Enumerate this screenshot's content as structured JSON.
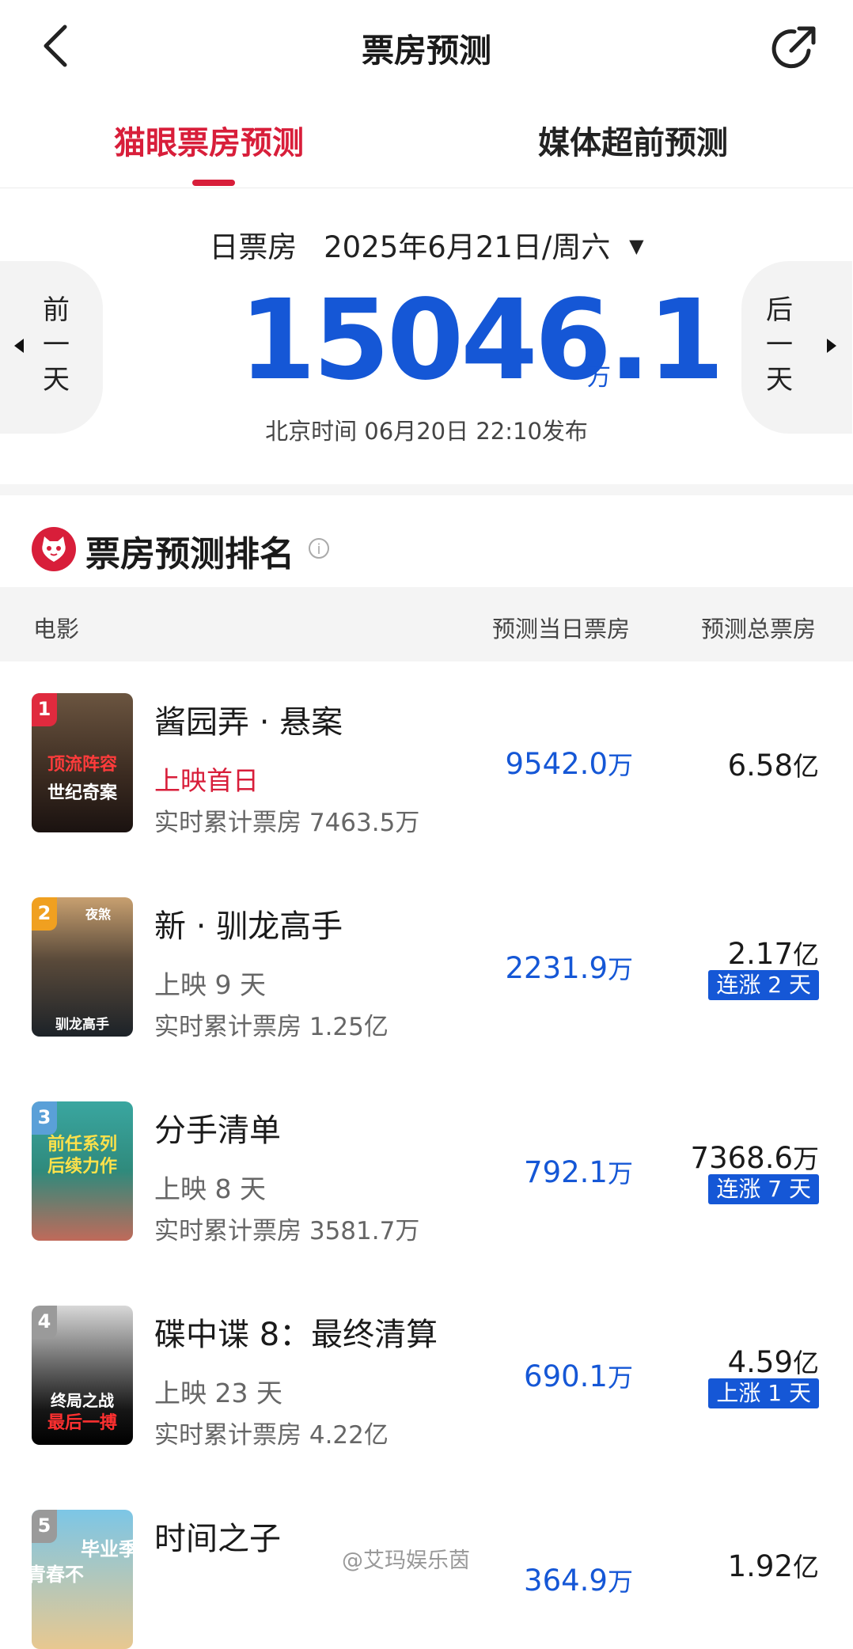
{
  "header": {
    "title": "票房预测"
  },
  "tabs": [
    {
      "label": "猫眼票房预测",
      "active": true
    },
    {
      "label": "媒体超前预测",
      "active": false
    }
  ],
  "date_selector": {
    "label": "日票房",
    "date": "2025年6月21日/周六",
    "caret": "▼"
  },
  "nav": {
    "prev": [
      "前",
      "一",
      "天"
    ],
    "next": [
      "后",
      "一",
      "天"
    ]
  },
  "summary": {
    "value": "15046.1",
    "unit": "万",
    "published": "北京时间  06月20日  22:10发布"
  },
  "ranking": {
    "title": "票房预测排名",
    "columns": {
      "movie": "电影",
      "day": "预测当日票房",
      "total": "预测总票房"
    },
    "rows": [
      {
        "rank": "1",
        "name": "酱园弄 · 悬案",
        "status": "上映首日",
        "status_red": true,
        "cumulative": "实时累计票房 7463.5万",
        "day_value": "9542.0",
        "day_unit": "万",
        "total_value": "6.58",
        "total_unit": "亿",
        "tag": "",
        "poster_text": [
          "顶流阵容",
          "世纪奇案"
        ]
      },
      {
        "rank": "2",
        "name": "新 · 驯龙高手",
        "status": "上映 9 天",
        "status_red": false,
        "cumulative": "实时累计票房 1.25亿",
        "day_value": "2231.9",
        "day_unit": "万",
        "total_value": "2.17",
        "total_unit": "亿",
        "tag": "连涨 2 天",
        "poster_text": [
          "夜煞",
          "驯龙高手"
        ]
      },
      {
        "rank": "3",
        "name": "分手清单",
        "status": "上映 8 天",
        "status_red": false,
        "cumulative": "实时累计票房 3581.7万",
        "day_value": "792.1",
        "day_unit": "万",
        "total_value": "7368.6",
        "total_unit": "万",
        "tag": "连涨 7 天",
        "poster_text": [
          "前任系列",
          "后续力作"
        ]
      },
      {
        "rank": "4",
        "name": "碟中谍 8：最终清算",
        "status": "上映 23 天",
        "status_red": false,
        "cumulative": "实时累计票房 4.22亿",
        "day_value": "690.1",
        "day_unit": "万",
        "total_value": "4.59",
        "total_unit": "亿",
        "tag": "上涨 1 天",
        "poster_text": [
          "终局之战",
          "最后一搏"
        ]
      },
      {
        "rank": "5",
        "name": "时间之子",
        "status": "",
        "status_red": false,
        "cumulative": "",
        "day_value": "364.9",
        "day_unit": "万",
        "total_value": "1.92",
        "total_unit": "亿",
        "tag": "",
        "poster_text": [
          "青春不",
          "毕业季"
        ]
      }
    ]
  },
  "watermark": "@艾玛娱乐茵",
  "colors": {
    "accent_red": "#d81e3a",
    "accent_blue": "#1557d6"
  }
}
